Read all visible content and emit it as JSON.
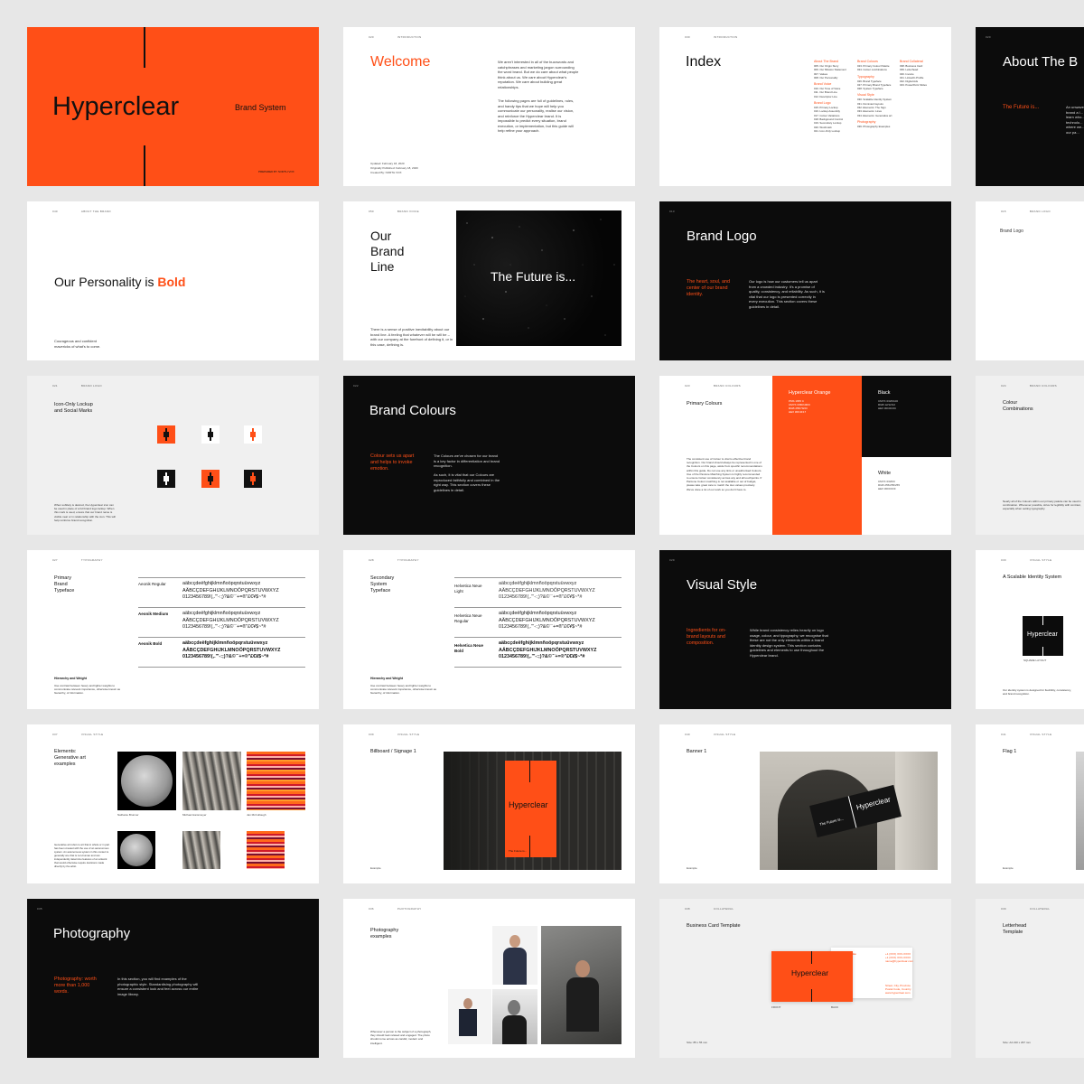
{
  "colors": {
    "orange": "#ff4f17",
    "black": "#0c0c0c",
    "white": "#ffffff",
    "grey": "#f0f0f0"
  },
  "s1": {
    "title": "Hyperclear",
    "subtitle": "Brand System",
    "credit": "PREPARED BY NORTH VOX"
  },
  "s2": {
    "header": [
      "020",
      "INTRODUCTION"
    ],
    "title": "Welcome",
    "p1": "We aren't interested in all of the buzzwords and catchphrases and marketing jargon surrounding the word brand. But we do care about what people think about us. We care about Hyperclear's reputation. We care about building great relationships.",
    "p2": "The following pages are full of guidelines, rules, and handy tips that we hope will help you communicate our personality, realise our vision, and reinforce the Hyperclear brand. It is impossible to predict every situation, brand execution, or implementation, but this guide will help refine your approach.",
    "meta": [
      "Updated: February 18, 2020",
      "Originally Published: February 18, 2020",
      "Created By: NORTH VOX"
    ]
  },
  "s3": {
    "header": [
      "030",
      "INTRODUCTION"
    ],
    "title": "Index",
    "col1": [
      {
        "h": "About The Brand"
      },
      {
        "t": "005. Our Origin Story"
      },
      {
        "t": "006. Our Mission Statement"
      },
      {
        "t": "007. Values"
      },
      {
        "t": "008. Our Personality"
      },
      {
        "h": "Brand Voice"
      },
      {
        "t": "010. Our Tone of Voice"
      },
      {
        "t": "011. Our Brand Line"
      },
      {
        "t": "012. Descriptor Line"
      },
      {
        "h": "Brand Logo"
      },
      {
        "t": "015. Primary Lockup"
      },
      {
        "t": "016. Lockup Assembly"
      },
      {
        "t": "017. Colour Variations"
      },
      {
        "t": "018. Background Control"
      },
      {
        "t": "019. Secondary Lockup"
      },
      {
        "t": "020. Wordmark"
      },
      {
        "t": "021. Icon-Only Lockup"
      }
    ],
    "col2": [
      {
        "h": "Brand Colours"
      },
      {
        "t": "023. Primary Colour Palette"
      },
      {
        "t": "024. Colour combinations"
      },
      {
        "h": "Typography"
      },
      {
        "t": "026. Brand Typeface"
      },
      {
        "t": "027. Primary Brand Typeface"
      },
      {
        "t": "028. System Typeface"
      },
      {
        "h": "Visual Style"
      },
      {
        "t": "030. Scalable Identity System"
      },
      {
        "t": "031. Dominant layouts"
      },
      {
        "t": "032. Elements: The Sign"
      },
      {
        "t": "033. Elements: Lines"
      },
      {
        "t": "034. Elements: Generative art"
      },
      {
        "h": "Photography"
      },
      {
        "t": "036. Photography Examples"
      }
    ],
    "col3": [
      {
        "h": "Brand Collateral"
      },
      {
        "t": "038. Business Card"
      },
      {
        "t": "039. Letterhead"
      },
      {
        "t": "040. Invoice"
      },
      {
        "t": "041. LinkedIn Profile"
      },
      {
        "t": "042. Digital Ads"
      },
      {
        "t": "043. PowerPoint Slides"
      }
    ]
  },
  "s4": {
    "title": "About The B",
    "subtitle": "The Future is...",
    "body": "An unwave... brand a l... learn who... technolo... where we... of our pa..."
  },
  "s5": {
    "header": [
      "040",
      "ABOUT THE BRAND"
    ],
    "title_pre": "Our Personality is ",
    "title_em": "Bold",
    "caption": "Courageous and confident mavericks of what's to come."
  },
  "s6": {
    "header": [
      "050",
      "BRAND VOICE"
    ],
    "title": "Our\nBrand\nLine",
    "image_text": "The Future is...",
    "body": "There is a sense of positive inevitability about our brand line. A feeling that whatever will be will be – with our company at the forefront of defining it, or in this case, defining is."
  },
  "s7": {
    "header": [
      "013"
    ],
    "title": "Brand Logo",
    "accent": "The heart, soul, and center of our brand identity.",
    "body": "Our logo is how our customers tell us apart from a crowded industry. It's a promise of quality, consistency, and reliability. As such, it is vital that our logo is presented correctly in every execution. This section covers these guidelines in detail."
  },
  "s8": {
    "header": [
      "015",
      "BRAND LOGO"
    ],
    "title": "Brand Logo"
  },
  "s9": {
    "header": [
      "021",
      "BRAND LOGO"
    ],
    "title": "Icon-Only Lockup\nand Social Marks",
    "body": "When subtlety is desired, the Hyperclear icon can be used in place of a full brand logo lockup. When this mark is used, ensure that our brand name is visible near or in relationship with the icon. This will help reinforce brand recognition."
  },
  "s10": {
    "header": [
      "022"
    ],
    "title": "Brand Colours",
    "accent": "Colour sets us apart and helps to invoke emotion.",
    "body1": "The Colours we've chosen for our brand is a key factor in differentiation and brand recognition.",
    "body2": "As such, it is vital that our Colours are reproduced faithfully and combined in the right way. This section covers these guidelines in detail."
  },
  "s11": {
    "header": [
      "023",
      "BRAND COLOURS"
    ],
    "title": "Primary Colours",
    "orange_name": "Hyperclear Orange",
    "orange_vals": [
      "PMS 1655 C",
      "CMYK 0/80/100/0",
      "RGB 255/79/23",
      "HEX #FF4F17"
    ],
    "black_name": "Black",
    "black_vals": [
      "CMYK 0/0/0/100",
      "RGB 12/12/12",
      "HEX #0C0C0C"
    ],
    "white_name": "White",
    "white_vals": [
      "CMYK 0/0/0/0",
      "RGB 255/255/255",
      "HEX #FFFFFF"
    ],
    "body": "The consistent use of Colour is vital to effective brand recognition. Our brand should always be represented in one of the Colours on this page, aside from specific recommendations within this guide. Do not use any tints or unauthorised Colours. Use of the Pantone Matching System is highly recommended to ensure Colour consistency across any and all touchpoints. If Pantone Colour matching is not available or out of budget, please take great care to match the Hex values precisely. We've done a lot of our work so you don't have to."
  },
  "s12": {
    "header": [
      "024",
      "BRAND COLOURS"
    ],
    "title": "Colour\nCombinations",
    "body": "Nearly all of the Colours within our primary palette can be used in combination. Whenever possible, strive for legibility with contrast, especially when setting typography."
  },
  "s13": {
    "header": [
      "027",
      "TYPOGRAPHY"
    ],
    "title": "Primary\nBrand\nTypeface",
    "fonts": [
      {
        "name": "Aeonik Regular",
        "bold": false
      },
      {
        "name": "Aeonik Medium",
        "bold": true
      },
      {
        "name": "Aeonik Bold",
        "bold": true
      }
    ],
    "glyph_lines": [
      "aäbcçdeëfghijklmnñoöpqrstuüvwxyz",
      "AÄBCÇDEFGHIJKLMNOÖPQRSTUVWXYZ",
      "0123456789!(,.'\"-:;)?&©¨¨+=®\"£€¥$~*#"
    ],
    "foot_title": "Hierarchy and Weight",
    "foot_body": "Use contrast between heavy and lighter weights to communicate relevant importance, otherwise known as hierarchy, of information."
  },
  "s14": {
    "header": [
      "028",
      "TYPOGRAPHY"
    ],
    "title": "Secondary\nSystem\nTypeface",
    "fonts": [
      {
        "name": "Helvetica Neue\nLight",
        "bold": false
      },
      {
        "name": "Helvetica Neue\nRegular",
        "bold": false
      },
      {
        "name": "Helvetica Neue\nBold",
        "bold": true
      }
    ],
    "glyph_lines": [
      "aäbcçdeëfghijklmnñoöpqrstuüvwxyz",
      "AÄBCÇDEFGHIJKLMNOÖPQRSTUVWXYZ",
      "0123456789!(,.'\"-:;)?&©¨¨+=®\"£€¥$~*#"
    ],
    "foot_title": "Hierarchy and Weight",
    "foot_body": "Use contrast between heavy and lighter weights to communicate relevant importance, otherwise known as hierarchy, of information."
  },
  "s15": {
    "header": [
      "029"
    ],
    "title": "Visual Style",
    "accent": "Ingredients for on-brand layouts and composition.",
    "body": "While brand consistency relies heavily on logo usage, colour, and typography, we recognise that these are not the only elements within a brand identity design system. This section contains guidelines and elements to use throughout the Hyperclear brand."
  },
  "s16": {
    "header": [
      "030",
      "VISUAL STYLE"
    ],
    "title": "A Scalable Identity System",
    "logo": "Hyperclear",
    "logo_caption": "SQUARE LAYOUT",
    "body": "Our identity system is designed for flexibility, consistency, and brand recognition."
  },
  "s17": {
    "header": [
      "037",
      "VISUAL STYLE"
    ],
    "title": "Elements:\nGenerative art\nexamples",
    "credits": [
      "Nathanie Brunner",
      "Michael Hansmeyer",
      "Jan McCullough"
    ],
    "body": "Generative art refers to art that in whole or in part has been created with the use of an autonomous system. An autonomous system in this context is generally one that is non-human and can independently determine features of an artwork that would otherwise require decisions made directly by the artist."
  },
  "s18": {
    "header": [
      "039",
      "VISUAL STYLE"
    ],
    "title": "Billboard / Signage 1",
    "sign": "Hyperclear",
    "sign_sub": "The Future is...",
    "caption": "Example"
  },
  "s19": {
    "header": [
      "040",
      "VISUAL STYLE"
    ],
    "title": "Banner 1",
    "banner_brand": "Hyperclear",
    "banner_line": "The Future is...",
    "caption": "Example"
  },
  "s20": {
    "header": [
      "041",
      "VISUAL STYLE"
    ],
    "title": "Flag 1",
    "caption": "Example"
  },
  "s21": {
    "header": [
      "035"
    ],
    "title": "Photography",
    "accent": "Photography: worth more than 1,000 words.",
    "body": "In this section, you will find examples of the photographic style. Standardising photography will ensure a consistent look and feel across our entire image library."
  },
  "s22": {
    "header": [
      "036",
      "PHOTOGRAPHY"
    ],
    "title": "Photography\nexamples",
    "body": "Whenever a person is the subject of a photograph, they should look relaxed and engaged. The photo should come across as candid, modern and intelligent."
  },
  "s23": {
    "header": [
      "038",
      "COLLATERAL"
    ],
    "title": "Business Card Template",
    "card_brand": "Hyperclear",
    "name": "Name Surname",
    "role": "Title",
    "contact": [
      "+1 (XXX) XXX-XXXX",
      "+1 (XXX) XXX-XXXX",
      "name@hyperclear.com"
    ],
    "address": [
      "Street, City, Province",
      "Postal Code, Country",
      "www.hyperclear.com"
    ],
    "front": "FRONT",
    "back": "BACK",
    "size": "Size: 85 x 55 mm"
  },
  "s24": {
    "header": [
      "039",
      "COLLATERAL"
    ],
    "title": "Letterhead\nTemplate",
    "size": "Size: A4 210 x 297 mm"
  }
}
